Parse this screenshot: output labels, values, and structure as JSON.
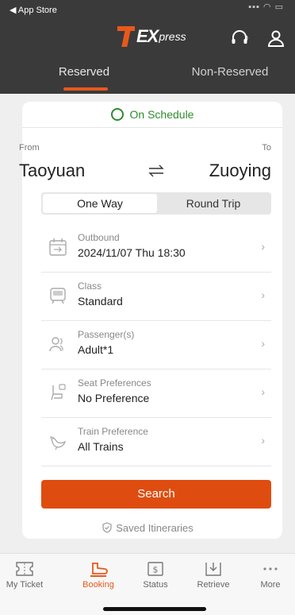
{
  "status_bar": {
    "back_label": "◀ App Store"
  },
  "header": {
    "logo": {
      "text": "EXpress",
      "accent": "#e8581d"
    },
    "icons": [
      "customer-service-icon",
      "user-icon"
    ]
  },
  "tabs": [
    {
      "label": "Reserved",
      "active": true
    },
    {
      "label": "Non-Reserved",
      "active": false
    }
  ],
  "schedule_status": "On Schedule",
  "route": {
    "from_label": "From",
    "to_label": "To",
    "from": "Taoyuan",
    "to": "Zuoying"
  },
  "trip_type": {
    "options": [
      "One Way",
      "Round Trip"
    ],
    "selected": "One Way"
  },
  "fields": [
    {
      "icon": "calendar-icon",
      "title": "Outbound",
      "value": "2024/11/07 Thu 18:30"
    },
    {
      "icon": "train-class-icon",
      "title": "Class",
      "value": "Standard"
    },
    {
      "icon": "passengers-icon",
      "title": "Passenger(s)",
      "value": "Adult*1"
    },
    {
      "icon": "seat-icon",
      "title": "Seat Preferences",
      "value": "No Preference"
    },
    {
      "icon": "bird-icon",
      "title": "Train Preference",
      "value": "All Trains"
    }
  ],
  "search_label": "Search",
  "saved_itineraries_label": "Saved Itineraries",
  "bottom_nav": [
    {
      "label": "My Ticket",
      "icon": "ticket-icon",
      "active": false
    },
    {
      "label": "Booking",
      "icon": "booking-icon",
      "active": true
    },
    {
      "label": "Status",
      "icon": "status-icon",
      "active": false
    },
    {
      "label": "Retrieve",
      "icon": "retrieve-icon",
      "active": false
    },
    {
      "label": "More",
      "icon": "more-icon",
      "active": false
    }
  ],
  "colors": {
    "accent": "#e8581d",
    "on_schedule": "#2e8b2e",
    "header_bg": "#3a3a3a"
  }
}
